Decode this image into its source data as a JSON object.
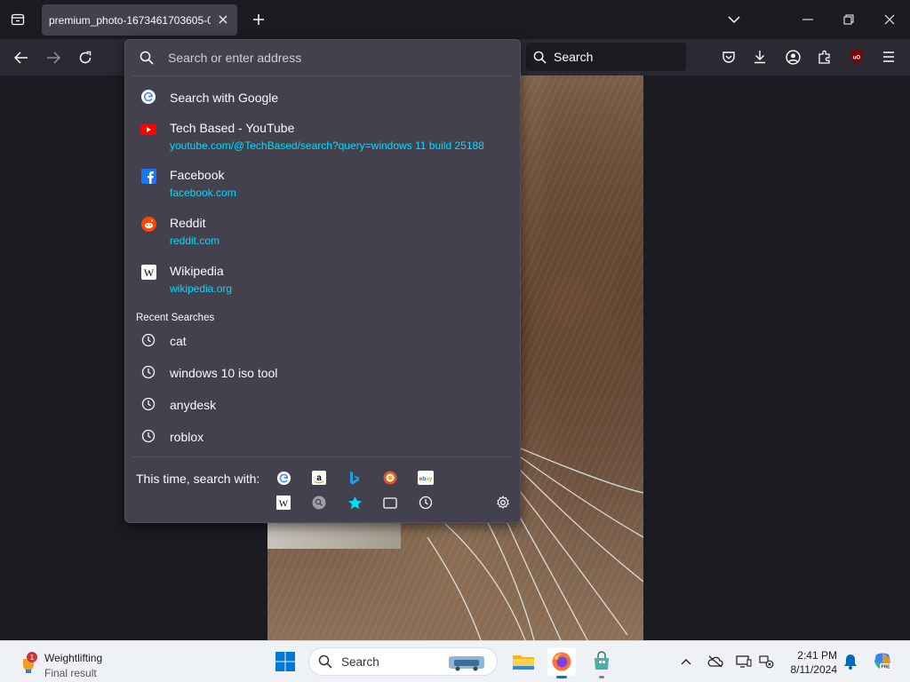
{
  "tab": {
    "title": "premium_photo-1673461703605-0c..."
  },
  "urlbar": {
    "placeholder": "Search or enter address"
  },
  "search_bar": {
    "label": "Search"
  },
  "suggestions": [
    {
      "icon": "google-icon",
      "title": "Search with Google",
      "url": ""
    },
    {
      "icon": "youtube-icon",
      "title": "Tech Based - YouTube",
      "url": "youtube.com/@TechBased/search?query=windows 11 build 25188"
    },
    {
      "icon": "facebook-icon",
      "title": "Facebook",
      "url": "facebook.com"
    },
    {
      "icon": "reddit-icon",
      "title": "Reddit",
      "url": "reddit.com"
    },
    {
      "icon": "wikipedia-icon",
      "title": "Wikipedia",
      "url": "wikipedia.org"
    }
  ],
  "recent": {
    "label": "Recent Searches",
    "items": [
      "cat",
      "windows 10 iso tool",
      "anydesk",
      "roblox"
    ]
  },
  "one_off": {
    "label": "This time, search with:",
    "engines_row1": [
      "google-icon",
      "amazon-icon",
      "bing-icon",
      "duckduckgo-icon",
      "ebay-icon"
    ],
    "engines_row2": [
      "wikipedia-icon",
      "search-engine-icon",
      "bookmarks-icon",
      "tabs-icon",
      "history-icon"
    ]
  },
  "taskbar": {
    "weather_title": "Weightlifting",
    "weather_sub": "Final result",
    "weather_badge": "1",
    "search_label": "Search",
    "time": "2:41 PM",
    "date": "8/11/2024"
  },
  "colors": {
    "accent_url": "#00ddff",
    "panel_bg": "#42414d",
    "toolbar_bg": "#2b2a33"
  }
}
